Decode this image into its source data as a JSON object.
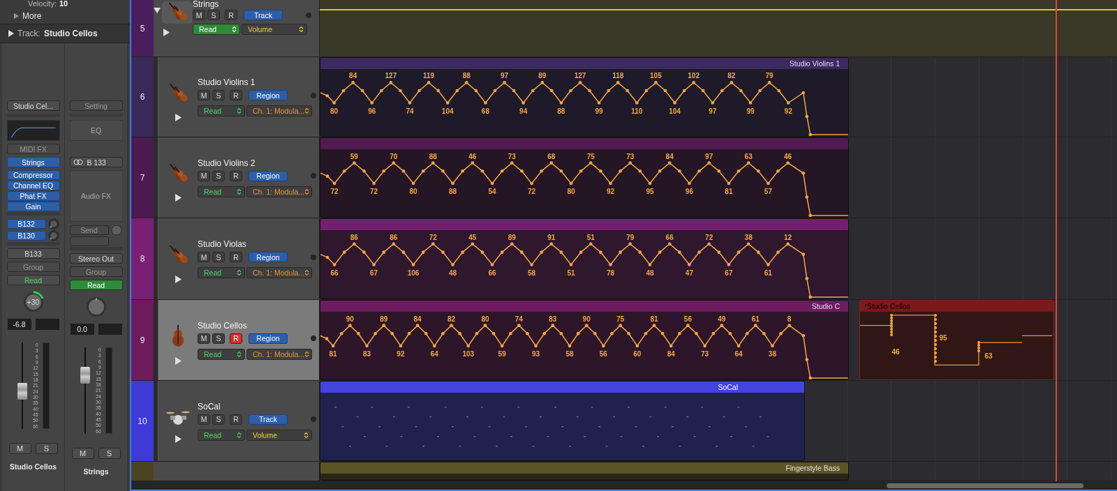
{
  "inspector": {
    "velocity_label": "Velocity:",
    "velocity_value": "10",
    "more": "More",
    "track_label": "Track:",
    "track_name": "Studio Cellos",
    "strips": [
      {
        "kind": "instrument",
        "setting": "Studio Cel...",
        "midi_fx": "MIDI FX",
        "input": "Strings",
        "audio_fx": [
          "Compressor",
          "Channel EQ",
          "Phat FX",
          "Gain"
        ],
        "sends": [
          "B132",
          "B130"
        ],
        "output": "B133",
        "group": "Group",
        "automation": "Read",
        "automation_highlighted": false,
        "pan": "+30",
        "volume": "-6.8",
        "scale": [
          "0",
          "3",
          "6",
          "9",
          "12",
          "15",
          "18",
          "21",
          "24",
          "30",
          "35",
          "40",
          "45",
          "50",
          "60"
        ],
        "fader": {
          "level": 0.42
        },
        "buttons": [
          {
            "label": "M",
            "on": false
          },
          {
            "label": "S",
            "on": false
          }
        ],
        "name": "Studio Cellos"
      },
      {
        "kind": "aux",
        "setting": "Setting",
        "eq": "EQ",
        "input": "B 133",
        "audio_fx_slot": "Audio FX",
        "sends": [
          "Send"
        ],
        "output": "Stereo Out",
        "group": "Group",
        "automation": "Read",
        "automation_highlighted": true,
        "volume": "0.0",
        "scale": [
          "0",
          "3",
          "6",
          "9",
          "12",
          "15",
          "18",
          "21",
          "24",
          "30",
          "35",
          "40",
          "45",
          "50",
          "60"
        ],
        "fader": {
          "level": 0.72
        },
        "buttons": [
          {
            "label": "M",
            "on": false
          },
          {
            "label": "S",
            "on": false
          }
        ],
        "name": "Strings"
      }
    ]
  },
  "tracks": [
    {
      "number": "5",
      "color": "#4a1d5c",
      "kind": "folder",
      "name": "Strings",
      "expanded": true,
      "selected": false,
      "buttons": [
        {
          "kind": "mute",
          "label": "M",
          "on": false
        },
        {
          "kind": "solo",
          "label": "S",
          "on": false
        },
        {
          "kind": "record",
          "label": "R",
          "on": false
        }
      ],
      "mode": "Track",
      "automation": "Read",
      "automation_highlighted": true,
      "parameter": "Volume"
    },
    {
      "number": "6",
      "color": "#3a2a5c",
      "kind": "violin",
      "name": "Studio Violins 1",
      "selected": false,
      "buttons": [
        {
          "kind": "mute",
          "label": "M",
          "on": false
        },
        {
          "kind": "solo",
          "label": "S",
          "on": false
        },
        {
          "kind": "record",
          "label": "R",
          "on": false
        }
      ],
      "mode": "Region",
      "automation": "Read",
      "automation_highlighted": false,
      "parameter": "Ch. 1: Modula...",
      "regions": [
        {
          "kind": "automation",
          "title": "Studio Violins 1",
          "color": "#3b2b5f",
          "labels": [
            "80",
            "84",
            "96",
            "127",
            "74",
            "119",
            "104",
            "88",
            "68",
            "97",
            "94",
            "89",
            "88",
            "127",
            "99",
            "118",
            "110",
            "105",
            "104",
            "102",
            "97",
            "82",
            "99",
            "79",
            "92"
          ]
        }
      ]
    },
    {
      "number": "7",
      "color": "#4d1a50",
      "kind": "violin",
      "name": "Studio Violins 2",
      "selected": false,
      "buttons": [
        {
          "kind": "mute",
          "label": "M",
          "on": false
        },
        {
          "kind": "solo",
          "label": "S",
          "on": false
        },
        {
          "kind": "record",
          "label": "R",
          "on": false
        }
      ],
      "mode": "Region",
      "automation": "Read",
      "automation_highlighted": false,
      "parameter": "Ch. 1: Modula...",
      "regions": [
        {
          "kind": "automation",
          "color": "#521a52",
          "labels": [
            "72",
            "59",
            "72",
            "70",
            "80",
            "88",
            "88",
            "46",
            "54",
            "73",
            "72",
            "68",
            "80",
            "75",
            "92",
            "73",
            "95",
            "84",
            "96",
            "97",
            "81",
            "63",
            "57",
            "46"
          ]
        }
      ]
    },
    {
      "number": "8",
      "color": "#7a2074",
      "kind": "violin",
      "name": "Studio Violas",
      "selected": false,
      "buttons": [
        {
          "kind": "mute",
          "label": "M",
          "on": false
        },
        {
          "kind": "solo",
          "label": "S",
          "on": false
        },
        {
          "kind": "record",
          "label": "R",
          "on": false
        }
      ],
      "mode": "Region",
      "automation": "Read",
      "automation_highlighted": false,
      "parameter": "Ch. 1: Modula...",
      "regions": [
        {
          "kind": "automation",
          "color": "#731f70",
          "labels": [
            "66",
            "86",
            "67",
            "86",
            "106",
            "72",
            "48",
            "45",
            "66",
            "89",
            "58",
            "91",
            "51",
            "51",
            "78",
            "79",
            "48",
            "66",
            "47",
            "72",
            "67",
            "38",
            "61",
            "12"
          ]
        }
      ]
    },
    {
      "number": "9",
      "color": "#6e1a5c",
      "kind": "cello",
      "name": "Studio Cellos",
      "selected": true,
      "buttons": [
        {
          "kind": "mute",
          "label": "M",
          "on": false
        },
        {
          "kind": "solo",
          "label": "S",
          "on": false
        },
        {
          "kind": "record",
          "label": "R",
          "on": true
        }
      ],
      "mode": "Region",
      "automation": "Read",
      "automation_highlighted": false,
      "parameter": "Ch. 1: Modula...",
      "regions": [
        {
          "kind": "automation",
          "title": "Studio C",
          "color": "#6e1c60",
          "labels": [
            "81",
            "90",
            "83",
            "89",
            "92",
            "84",
            "64",
            "82",
            "103",
            "80",
            "59",
            "74",
            "93",
            "83",
            "58",
            "90",
            "56",
            "75",
            "60",
            "81",
            "84",
            "56",
            "73",
            "49",
            "64",
            "61",
            "38",
            "8"
          ]
        },
        {
          "kind": "step",
          "title": "*Studio Cellos",
          "color": "#7a1a1a",
          "labels": [
            "46",
            "95",
            "63"
          ]
        }
      ]
    },
    {
      "number": "10",
      "color": "#3d3ad8",
      "kind": "drummer",
      "name": "SoCal",
      "selected": false,
      "buttons": [
        {
          "kind": "mute",
          "label": "M",
          "on": false
        },
        {
          "kind": "solo",
          "label": "S",
          "on": false
        },
        {
          "kind": "record",
          "label": "R",
          "on": false
        }
      ],
      "mode": "Track",
      "automation": "Read",
      "automation_highlighted": false,
      "parameter": "Volume",
      "regions": [
        {
          "kind": "drummer",
          "title": "SoCal",
          "color": "#4343e0"
        }
      ]
    },
    {
      "color": "#4a4420",
      "kind": "bass",
      "regions": [
        {
          "kind": "midi",
          "title": "Fingerstyle Bass",
          "color": "#5c5424"
        }
      ]
    }
  ]
}
